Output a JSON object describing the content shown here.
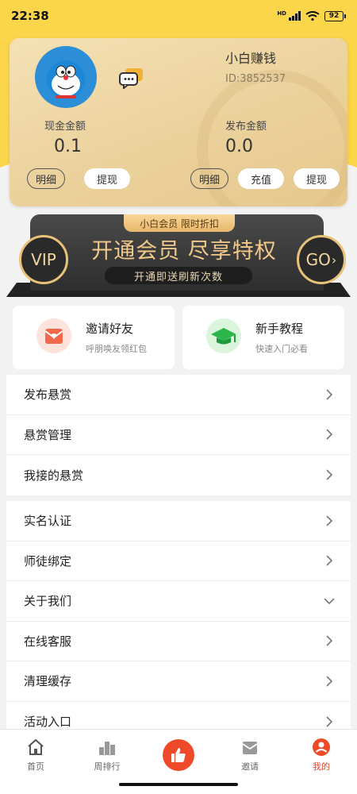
{
  "status_bar": {
    "time": "22:38",
    "hd": "HD",
    "battery": "92"
  },
  "wallet": {
    "user_name": "小白赚钱",
    "user_id": "ID:3852537",
    "cash_label": "现金金额",
    "cash_value": "0.1",
    "publish_label": "发布金额",
    "publish_value": "0.0",
    "buttons": {
      "detail": "明细",
      "withdraw": "提现",
      "recharge": "充值"
    }
  },
  "vip": {
    "tag": "小白会员 限时折扣",
    "title": "开通会员 尽享特权",
    "subtitle": "开通即送刷新次数",
    "vip_label": "VIP",
    "go_label": "GO",
    "go_arrow": "›"
  },
  "features": [
    {
      "title": "邀请好友",
      "subtitle": "呼朋唤友领红包",
      "icon": "envelope-icon"
    },
    {
      "title": "新手教程",
      "subtitle": "快速入门必看",
      "icon": "graduation-cap-icon"
    }
  ],
  "menu_group_1": [
    "发布悬赏",
    "悬赏管理",
    "我接的悬赏"
  ],
  "menu_group_2": [
    "实名认证",
    "师徒绑定",
    "关于我们",
    "在线客服",
    "清理缓存",
    "活动入口"
  ],
  "bottom_nav": {
    "items": [
      {
        "label": "首页",
        "icon": "home-icon"
      },
      {
        "label": "周排行",
        "icon": "ranking-icon"
      },
      {
        "label": "",
        "icon": "thumbs-up-icon"
      },
      {
        "label": "邀请",
        "icon": "invite-icon"
      },
      {
        "label": "我的",
        "icon": "profile-icon"
      }
    ],
    "active": "我的"
  },
  "colors": {
    "accent": "#ee4a2a",
    "top_yellow": "#fbd54a",
    "gold": "#e9c27a"
  }
}
